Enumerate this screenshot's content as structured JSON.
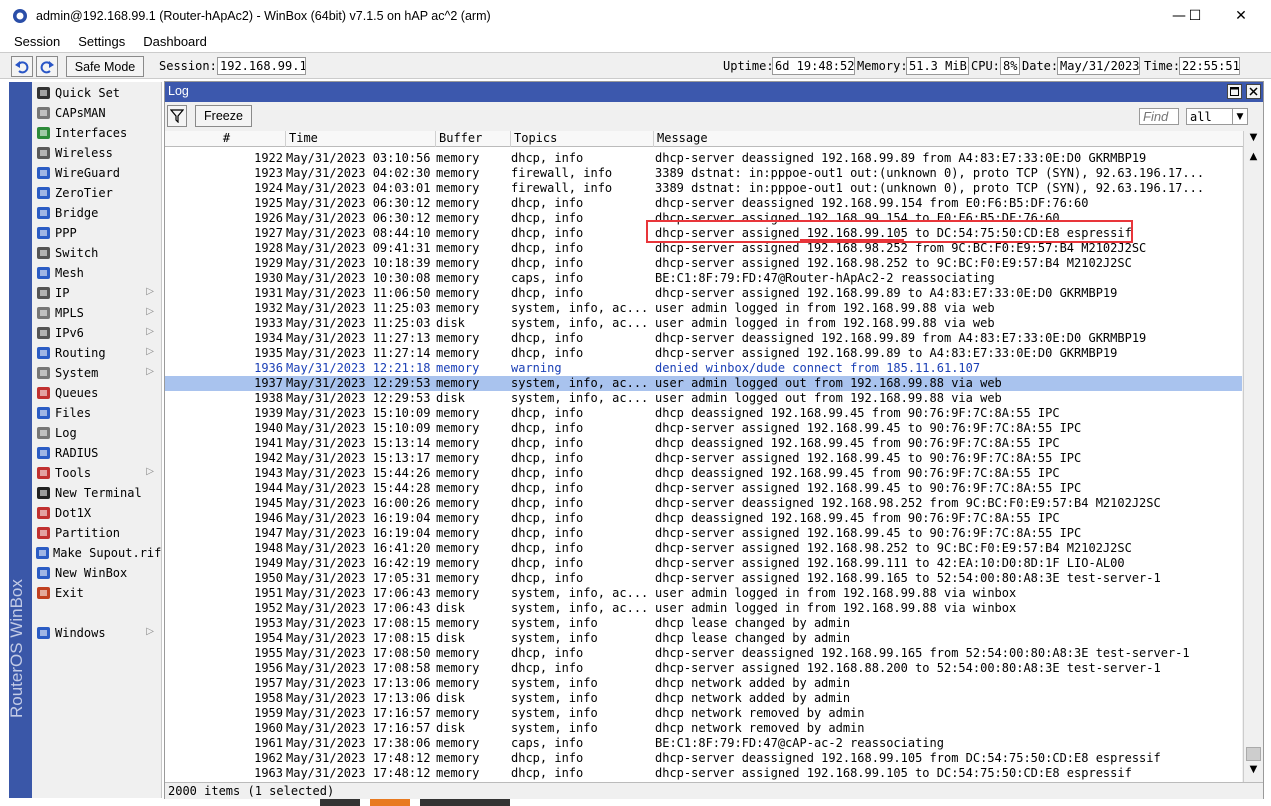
{
  "window": {
    "title": "admin@192.168.99.1 (Router-hApAc2) - WinBox (64bit) v7.1.5 on hAP ac^2 (arm)",
    "minimize": "—",
    "maximize": "☐",
    "close": "✕"
  },
  "menubar": [
    "Session",
    "Settings",
    "Dashboard"
  ],
  "toolbar": {
    "safe_mode": "Safe Mode",
    "session_label": "Session:",
    "session_value": "192.168.99.1",
    "uptime_label": "Uptime:",
    "uptime_value": "6d 19:48:52",
    "memory_label": "Memory:",
    "memory_value": "51.3 MiB",
    "cpu_label": "CPU:",
    "cpu_value": "8%",
    "date_label": "Date:",
    "date_value": "May/31/2023",
    "time_label": "Time:",
    "time_value": "22:55:51"
  },
  "brand": "RouterOS WinBox",
  "sidebar": {
    "items": [
      {
        "label": "Quick Set",
        "icon": "wand-icon",
        "submenu": false
      },
      {
        "label": "CAPsMAN",
        "icon": "capsman-icon",
        "submenu": false
      },
      {
        "label": "Interfaces",
        "icon": "interfaces-icon",
        "submenu": false
      },
      {
        "label": "Wireless",
        "icon": "wireless-icon",
        "submenu": false
      },
      {
        "label": "WireGuard",
        "icon": "wireguard-icon",
        "submenu": false
      },
      {
        "label": "ZeroTier",
        "icon": "zerotier-icon",
        "submenu": false
      },
      {
        "label": "Bridge",
        "icon": "bridge-icon",
        "submenu": false
      },
      {
        "label": "PPP",
        "icon": "ppp-icon",
        "submenu": false
      },
      {
        "label": "Switch",
        "icon": "switch-icon",
        "submenu": false
      },
      {
        "label": "Mesh",
        "icon": "mesh-icon",
        "submenu": false
      },
      {
        "label": "IP",
        "icon": "ip-icon",
        "submenu": true
      },
      {
        "label": "MPLS",
        "icon": "mpls-icon",
        "submenu": true
      },
      {
        "label": "IPv6",
        "icon": "ipv6-icon",
        "submenu": true
      },
      {
        "label": "Routing",
        "icon": "routing-icon",
        "submenu": true
      },
      {
        "label": "System",
        "icon": "system-icon",
        "submenu": true
      },
      {
        "label": "Queues",
        "icon": "queues-icon",
        "submenu": false
      },
      {
        "label": "Files",
        "icon": "files-icon",
        "submenu": false
      },
      {
        "label": "Log",
        "icon": "log-icon",
        "submenu": false
      },
      {
        "label": "RADIUS",
        "icon": "radius-icon",
        "submenu": false
      },
      {
        "label": "Tools",
        "icon": "tools-icon",
        "submenu": true
      },
      {
        "label": "New Terminal",
        "icon": "terminal-icon",
        "submenu": false
      },
      {
        "label": "Dot1X",
        "icon": "dot1x-icon",
        "submenu": false
      },
      {
        "label": "Partition",
        "icon": "partition-icon",
        "submenu": false
      },
      {
        "label": "Make Supout.rif",
        "icon": "supout-icon",
        "submenu": false
      },
      {
        "label": "New WinBox",
        "icon": "winbox-icon",
        "submenu": false
      },
      {
        "label": "Exit",
        "icon": "exit-icon",
        "submenu": false
      },
      {
        "label": "Windows",
        "icon": "windows-icon",
        "submenu": true
      }
    ]
  },
  "log": {
    "title": "Log",
    "freeze": "Freeze",
    "find_placeholder": "Find",
    "filter_value": "all",
    "columns": [
      "#",
      "Time",
      "Buffer",
      "Topics",
      "Message"
    ],
    "status": "2000 items (1 selected)",
    "rows": [
      [
        "1922",
        "May/31/2023 03:10:56",
        "memory",
        "dhcp, info",
        "dhcp-server deassigned 192.168.99.89 from A4:83:E7:33:0E:D0 GKRMBP19"
      ],
      [
        "1923",
        "May/31/2023 04:02:30",
        "memory",
        "firewall, info",
        "3389 dstnat: in:pppoe-out1 out:(unknown 0), proto TCP (SYN), 92.63.196.17..."
      ],
      [
        "1924",
        "May/31/2023 04:03:01",
        "memory",
        "firewall, info",
        "3389 dstnat: in:pppoe-out1 out:(unknown 0), proto TCP (SYN), 92.63.196.17..."
      ],
      [
        "1925",
        "May/31/2023 06:30:12",
        "memory",
        "dhcp, info",
        "dhcp-server deassigned 192.168.99.154 from E0:F6:B5:DF:76:60"
      ],
      [
        "1926",
        "May/31/2023 06:30:12",
        "memory",
        "dhcp, info",
        "dhcp-server assigned 192.168.99.154 to E0:F6:B5:DF:76:60"
      ],
      [
        "1927",
        "May/31/2023 08:44:10",
        "memory",
        "dhcp, info",
        "dhcp-server assigned 192.168.99.105 to DC:54:75:50:CD:E8 espressif"
      ],
      [
        "1928",
        "May/31/2023 09:41:31",
        "memory",
        "dhcp, info",
        "dhcp-server assigned 192.168.98.252 from 9C:BC:F0:E9:57:B4 M2102J2SC"
      ],
      [
        "1929",
        "May/31/2023 10:18:39",
        "memory",
        "dhcp, info",
        "dhcp-server assigned 192.168.98.252 to 9C:BC:F0:E9:57:B4 M2102J2SC"
      ],
      [
        "1930",
        "May/31/2023 10:30:08",
        "memory",
        "caps, info",
        "BE:C1:8F:79:FD:47@Router-hApAc2-2 reassociating"
      ],
      [
        "1931",
        "May/31/2023 11:06:50",
        "memory",
        "dhcp, info",
        "dhcp-server assigned 192.168.99.89 to A4:83:E7:33:0E:D0 GKRMBP19"
      ],
      [
        "1932",
        "May/31/2023 11:25:03",
        "memory",
        "system, info, ac...",
        "user admin logged in from 192.168.99.88 via web"
      ],
      [
        "1933",
        "May/31/2023 11:25:03",
        "disk",
        "system, info, ac...",
        "user admin logged in from 192.168.99.88 via web"
      ],
      [
        "1934",
        "May/31/2023 11:27:13",
        "memory",
        "dhcp, info",
        "dhcp-server deassigned 192.168.99.89 from A4:83:E7:33:0E:D0 GKRMBP19"
      ],
      [
        "1935",
        "May/31/2023 11:27:14",
        "memory",
        "dhcp, info",
        "dhcp-server assigned 192.168.99.89 to A4:83:E7:33:0E:D0 GKRMBP19"
      ],
      [
        "1936",
        "May/31/2023 12:21:18",
        "memory",
        "warning",
        "denied winbox/dude connect from 185.11.61.107"
      ],
      [
        "1937",
        "May/31/2023 12:29:53",
        "memory",
        "system, info, ac...",
        "user admin logged out from 192.168.99.88 via web"
      ],
      [
        "1938",
        "May/31/2023 12:29:53",
        "disk",
        "system, info, ac...",
        "user admin logged out from 192.168.99.88 via web"
      ],
      [
        "1939",
        "May/31/2023 15:10:09",
        "memory",
        "dhcp, info",
        "dhcp deassigned 192.168.99.45 from 90:76:9F:7C:8A:55 IPC"
      ],
      [
        "1940",
        "May/31/2023 15:10:09",
        "memory",
        "dhcp, info",
        "dhcp-server assigned 192.168.99.45 to 90:76:9F:7C:8A:55 IPC"
      ],
      [
        "1941",
        "May/31/2023 15:13:14",
        "memory",
        "dhcp, info",
        "dhcp deassigned 192.168.99.45 from 90:76:9F:7C:8A:55 IPC"
      ],
      [
        "1942",
        "May/31/2023 15:13:17",
        "memory",
        "dhcp, info",
        "dhcp-server assigned 192.168.99.45 to 90:76:9F:7C:8A:55 IPC"
      ],
      [
        "1943",
        "May/31/2023 15:44:26",
        "memory",
        "dhcp, info",
        "dhcp deassigned 192.168.99.45 from 90:76:9F:7C:8A:55 IPC"
      ],
      [
        "1944",
        "May/31/2023 15:44:28",
        "memory",
        "dhcp, info",
        "dhcp-server assigned 192.168.99.45 to 90:76:9F:7C:8A:55 IPC"
      ],
      [
        "1945",
        "May/31/2023 16:00:26",
        "memory",
        "dhcp, info",
        "dhcp-server deassigned 192.168.98.252 from 9C:BC:F0:E9:57:B4 M2102J2SC"
      ],
      [
        "1946",
        "May/31/2023 16:19:04",
        "memory",
        "dhcp, info",
        "dhcp deassigned 192.168.99.45 from 90:76:9F:7C:8A:55 IPC"
      ],
      [
        "1947",
        "May/31/2023 16:19:04",
        "memory",
        "dhcp, info",
        "dhcp-server assigned 192.168.99.45 to 90:76:9F:7C:8A:55 IPC"
      ],
      [
        "1948",
        "May/31/2023 16:41:20",
        "memory",
        "dhcp, info",
        "dhcp-server assigned 192.168.98.252 to 9C:BC:F0:E9:57:B4 M2102J2SC"
      ],
      [
        "1949",
        "May/31/2023 16:42:19",
        "memory",
        "dhcp, info",
        "dhcp-server assigned 192.168.99.111 to 42:EA:10:D0:8D:1F LIO-AL00"
      ],
      [
        "1950",
        "May/31/2023 17:05:31",
        "memory",
        "dhcp, info",
        "dhcp-server assigned 192.168.99.165 to 52:54:00:80:A8:3E test-server-1"
      ],
      [
        "1951",
        "May/31/2023 17:06:43",
        "memory",
        "system, info, ac...",
        "user admin logged in from 192.168.99.88 via winbox"
      ],
      [
        "1952",
        "May/31/2023 17:06:43",
        "disk",
        "system, info, ac...",
        "user admin logged in from 192.168.99.88 via winbox"
      ],
      [
        "1953",
        "May/31/2023 17:08:15",
        "memory",
        "system, info",
        "dhcp lease changed by admin"
      ],
      [
        "1954",
        "May/31/2023 17:08:15",
        "disk",
        "system, info",
        "dhcp lease changed by admin"
      ],
      [
        "1955",
        "May/31/2023 17:08:50",
        "memory",
        "dhcp, info",
        "dhcp-server deassigned 192.168.99.165 from 52:54:00:80:A8:3E test-server-1"
      ],
      [
        "1956",
        "May/31/2023 17:08:58",
        "memory",
        "dhcp, info",
        "dhcp-server assigned 192.168.88.200 to 52:54:00:80:A8:3E test-server-1"
      ],
      [
        "1957",
        "May/31/2023 17:13:06",
        "memory",
        "system, info",
        "dhcp network added by admin"
      ],
      [
        "1958",
        "May/31/2023 17:13:06",
        "disk",
        "system, info",
        "dhcp network added by admin"
      ],
      [
        "1959",
        "May/31/2023 17:16:57",
        "memory",
        "system, info",
        "dhcp network removed by admin"
      ],
      [
        "1960",
        "May/31/2023 17:16:57",
        "disk",
        "system, info",
        "dhcp network removed by admin"
      ],
      [
        "1961",
        "May/31/2023 17:38:06",
        "memory",
        "caps, info",
        "BE:C1:8F:79:FD:47@cAP-ac-2 reassociating"
      ],
      [
        "1962",
        "May/31/2023 17:48:12",
        "memory",
        "dhcp, info",
        "dhcp-server deassigned 192.168.99.105 from DC:54:75:50:CD:E8 espressif"
      ],
      [
        "1963",
        "May/31/2023 17:48:12",
        "memory",
        "dhcp, info",
        "dhcp-server assigned 192.168.99.105 to DC:54:75:50:CD:E8 espressif"
      ]
    ],
    "selected_index": 15,
    "warning_index": 14
  },
  "colors": {
    "header_blue": "#3c58ad",
    "selected_row": "#a9c3ee",
    "warning_text": "#1a3fb5",
    "annotation_red": "#e8353a"
  }
}
